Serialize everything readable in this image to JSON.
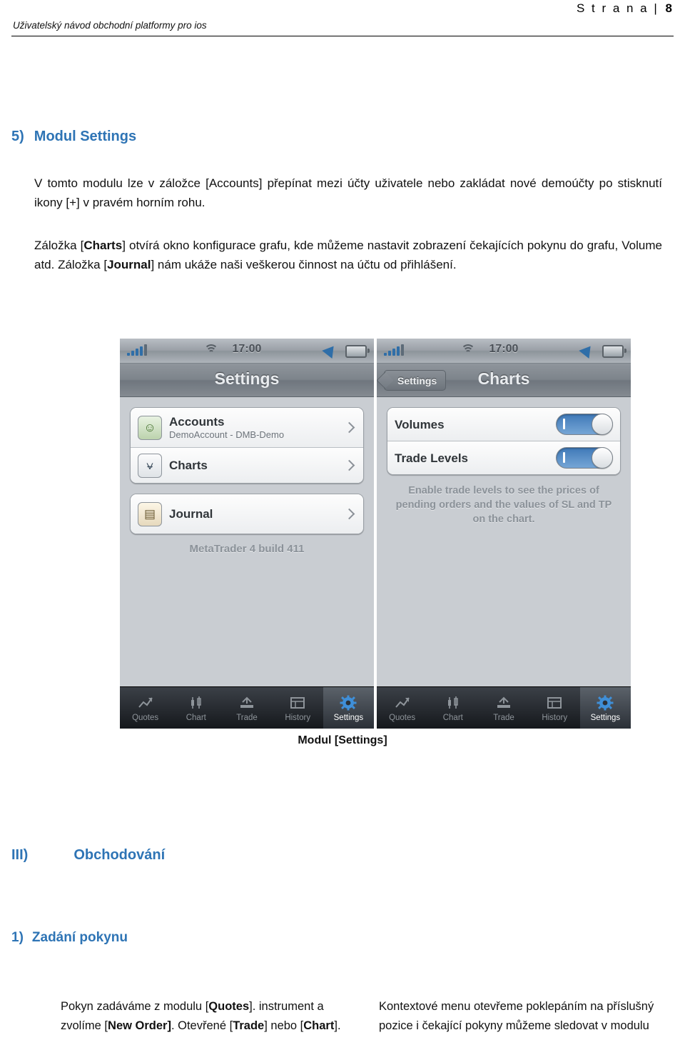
{
  "header": {
    "page_label": "S t r a n a",
    "page_separator": "|",
    "page_number": "8",
    "doc_title": "Uživatelský návod obchodní platformy pro ios"
  },
  "section": {
    "number": "5)",
    "title": "Modul Settings",
    "paragraph1": "V tomto modulu lze v záložce [Accounts] přepínat mezi účty uživatele nebo zakládat nové demoúčty po stisknutí ikony [+] v pravém horním rohu.",
    "paragraph2_parts": {
      "a": "Záložka [",
      "b_charts": "Charts",
      "c": "] otvírá okno konfigurace grafu, kde můžeme nastavit zobrazení čekajících pokynu do grafu, Volume atd. Záložka [",
      "d_journal": "Journal",
      "e": "] nám ukáže naši veškerou činnost na účtu od přihlášení."
    }
  },
  "figure": {
    "caption": "Modul [Settings]",
    "phone_left": {
      "status": {
        "time": "17:00"
      },
      "nav": {
        "title": "Settings"
      },
      "rows": [
        {
          "icon": "accounts-icon",
          "title": "Accounts",
          "subtitle": "DemoAccount - DMB-Demo"
        },
        {
          "icon": "charts-icon",
          "title": "Charts",
          "subtitle": ""
        },
        {
          "icon": "journal-icon",
          "title": "Journal",
          "subtitle": ""
        }
      ],
      "build": "MetaTrader 4 build 411",
      "tabs": [
        {
          "label": "Quotes",
          "icon": "quotes-icon",
          "active": false
        },
        {
          "label": "Chart",
          "icon": "chart-icon",
          "active": false
        },
        {
          "label": "Trade",
          "icon": "trade-icon",
          "active": false
        },
        {
          "label": "History",
          "icon": "history-icon",
          "active": false
        },
        {
          "label": "Settings",
          "icon": "settings-gear-icon",
          "active": true
        }
      ]
    },
    "phone_right": {
      "status": {
        "time": "17:00"
      },
      "nav": {
        "back_label": "Settings",
        "title": "Charts"
      },
      "rows": [
        {
          "title": "Volumes",
          "toggle": "on"
        },
        {
          "title": "Trade Levels",
          "toggle": "on"
        }
      ],
      "hint": "Enable trade levels to see the prices of pending orders and the values of SL and TP on the chart.",
      "tabs": [
        {
          "label": "Quotes",
          "icon": "quotes-icon",
          "active": false
        },
        {
          "label": "Chart",
          "icon": "chart-icon",
          "active": false
        },
        {
          "label": "Trade",
          "icon": "trade-icon",
          "active": false
        },
        {
          "label": "History",
          "icon": "history-icon",
          "active": false
        },
        {
          "label": "Settings",
          "icon": "settings-gear-icon",
          "active": true
        }
      ]
    }
  },
  "section_iii": {
    "number": "III)",
    "title": "Obchodování"
  },
  "subsection": {
    "number": "1)",
    "title": "Zadání pokynu"
  },
  "columns": {
    "left_parts": {
      "a": "Pokyn zadáváme z modulu [",
      "b_quotes": "Quotes",
      "c": "]. instrument a zvolíme [",
      "d_neworder": "New Order]",
      "e": ". Otevřené [",
      "f_trade": "Trade",
      "g": "] nebo [",
      "h_chart": "Chart",
      "i": "]."
    },
    "right": "Kontextové menu otevřeme poklepáním na příslušný pozice i čekající pokyny můžeme sledovat v modulu"
  },
  "colors": {
    "heading_blue": "#2e74b5",
    "toggle_on": "#3f79b8",
    "tab_active_text": "#ffffff"
  }
}
